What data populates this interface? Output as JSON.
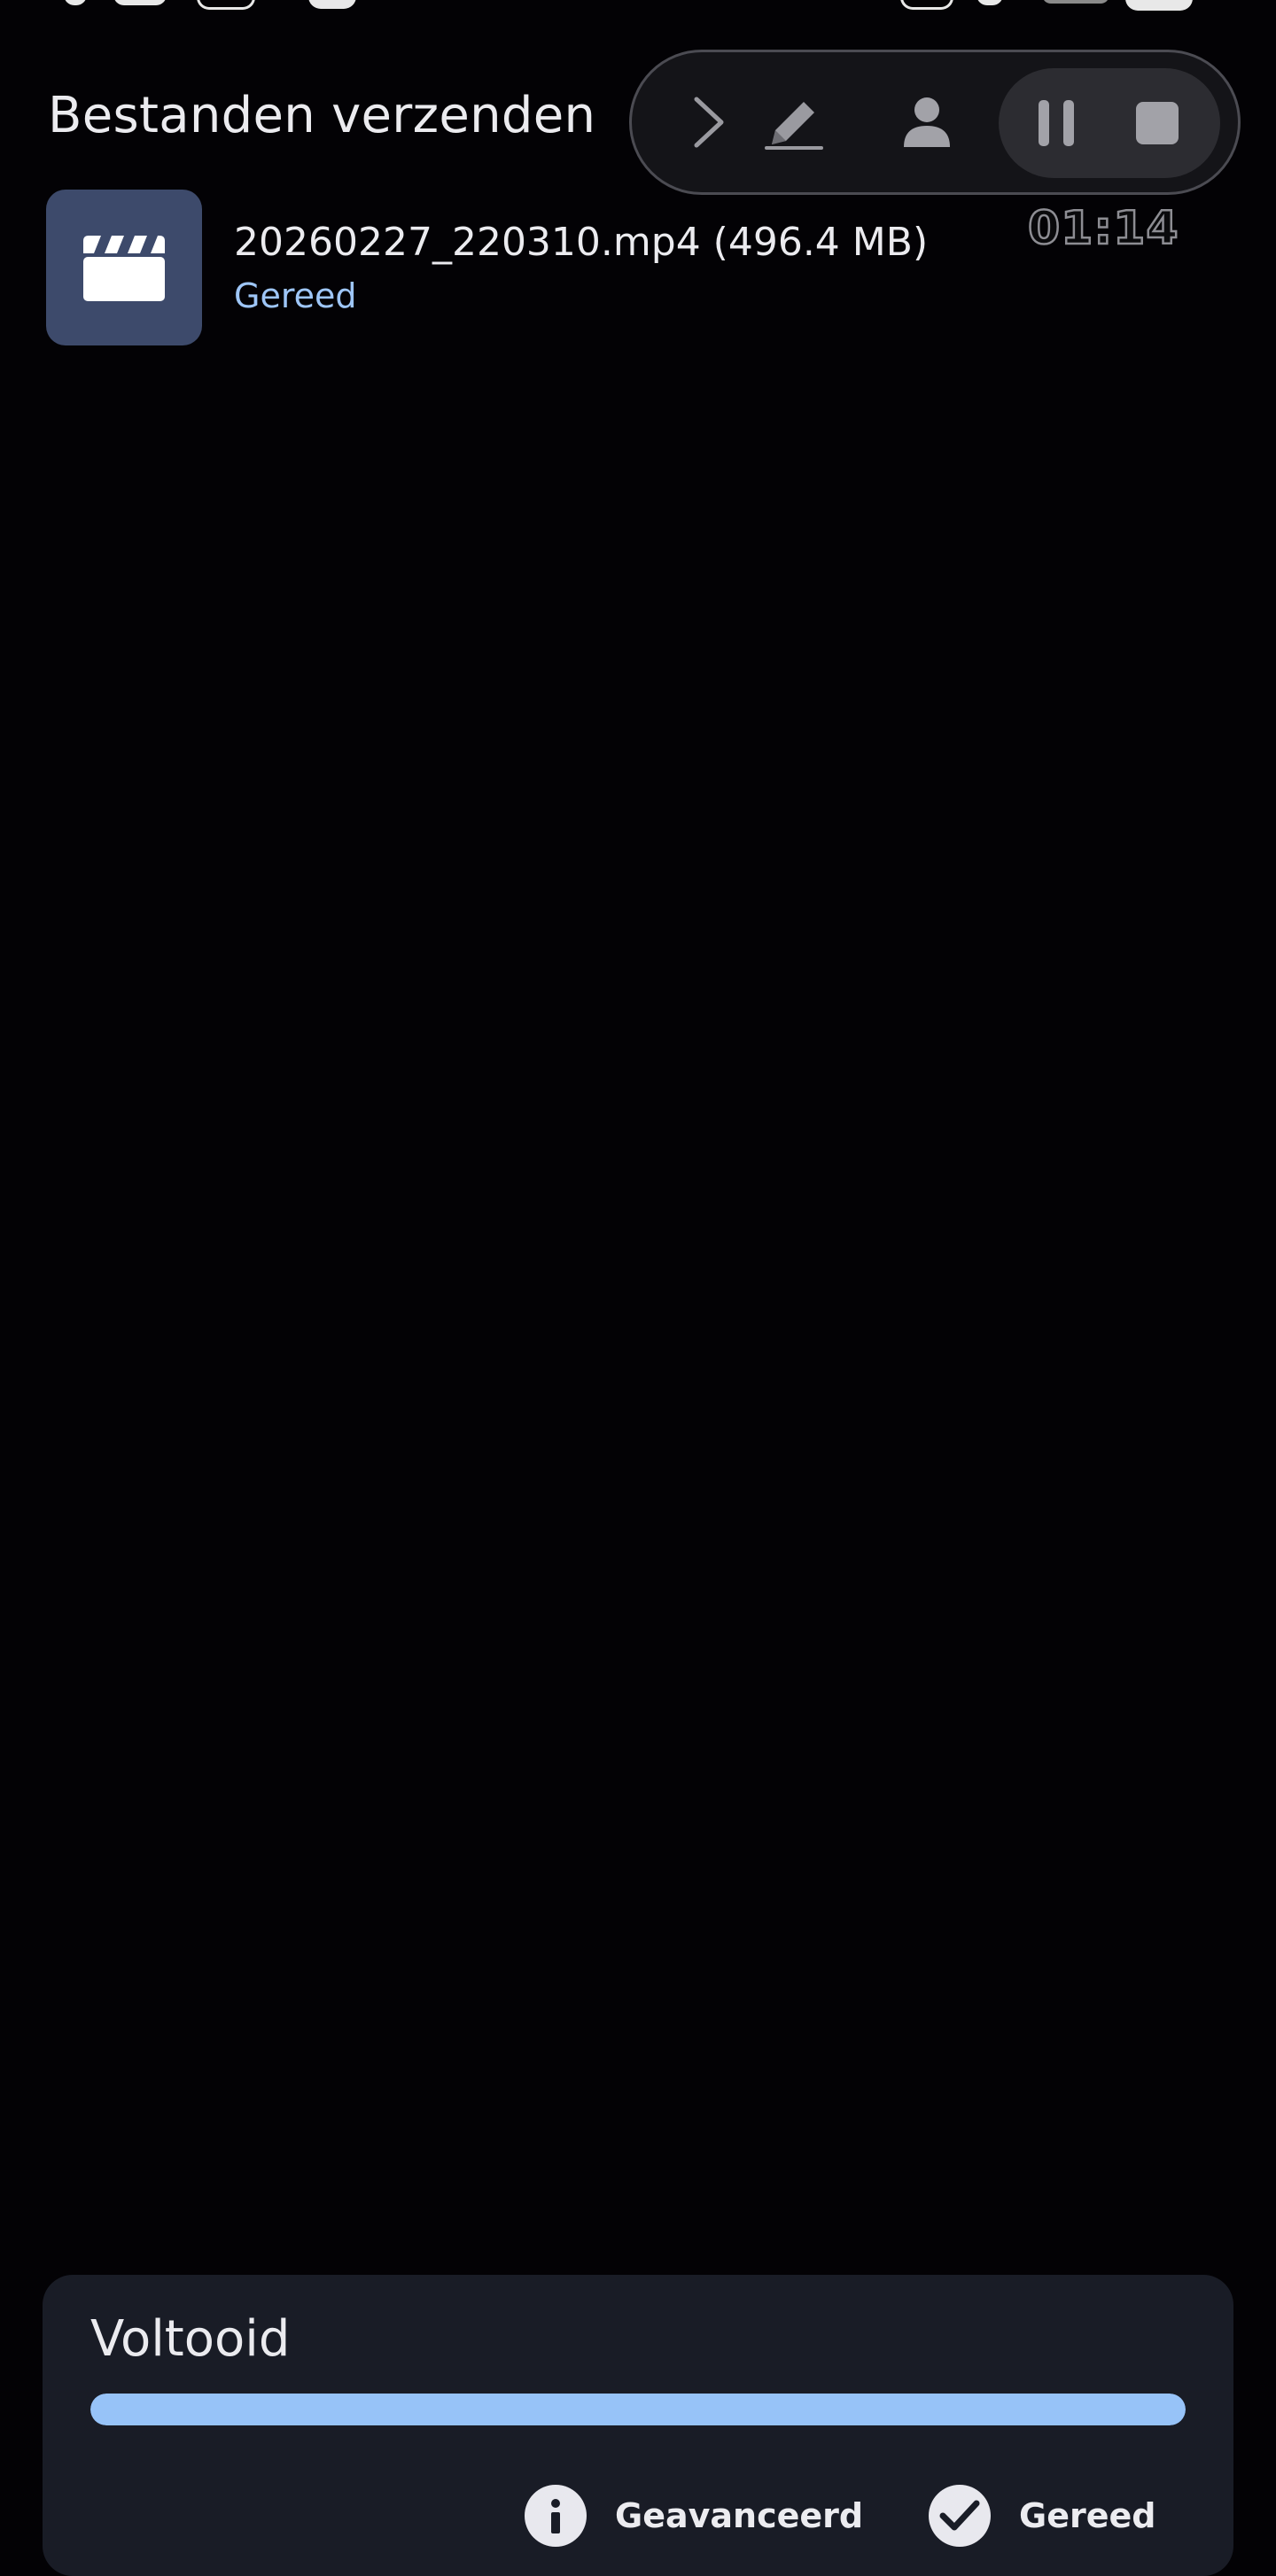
{
  "header": {
    "title": "Bestanden verzenden"
  },
  "recorder": {
    "timer": "01:14",
    "icons": [
      "chevron-right-icon",
      "pencil-icon",
      "person-icon",
      "pause-icon",
      "stop-icon"
    ]
  },
  "files": [
    {
      "name": "20260227_220310.mp4 (496.4 MB)",
      "status": "Gereed",
      "icon": "clapperboard-icon"
    }
  ],
  "sheet": {
    "title": "Voltooid",
    "progress": 1.0,
    "advanced_label": "Geavanceerd",
    "done_label": "Gereed"
  },
  "colors": {
    "accent": "#97c3f8",
    "status_text": "#9ec6f8",
    "thumbnail_bg": "#3d4a6b",
    "sheet_bg": "#191c26",
    "page_bg": "#030205"
  }
}
